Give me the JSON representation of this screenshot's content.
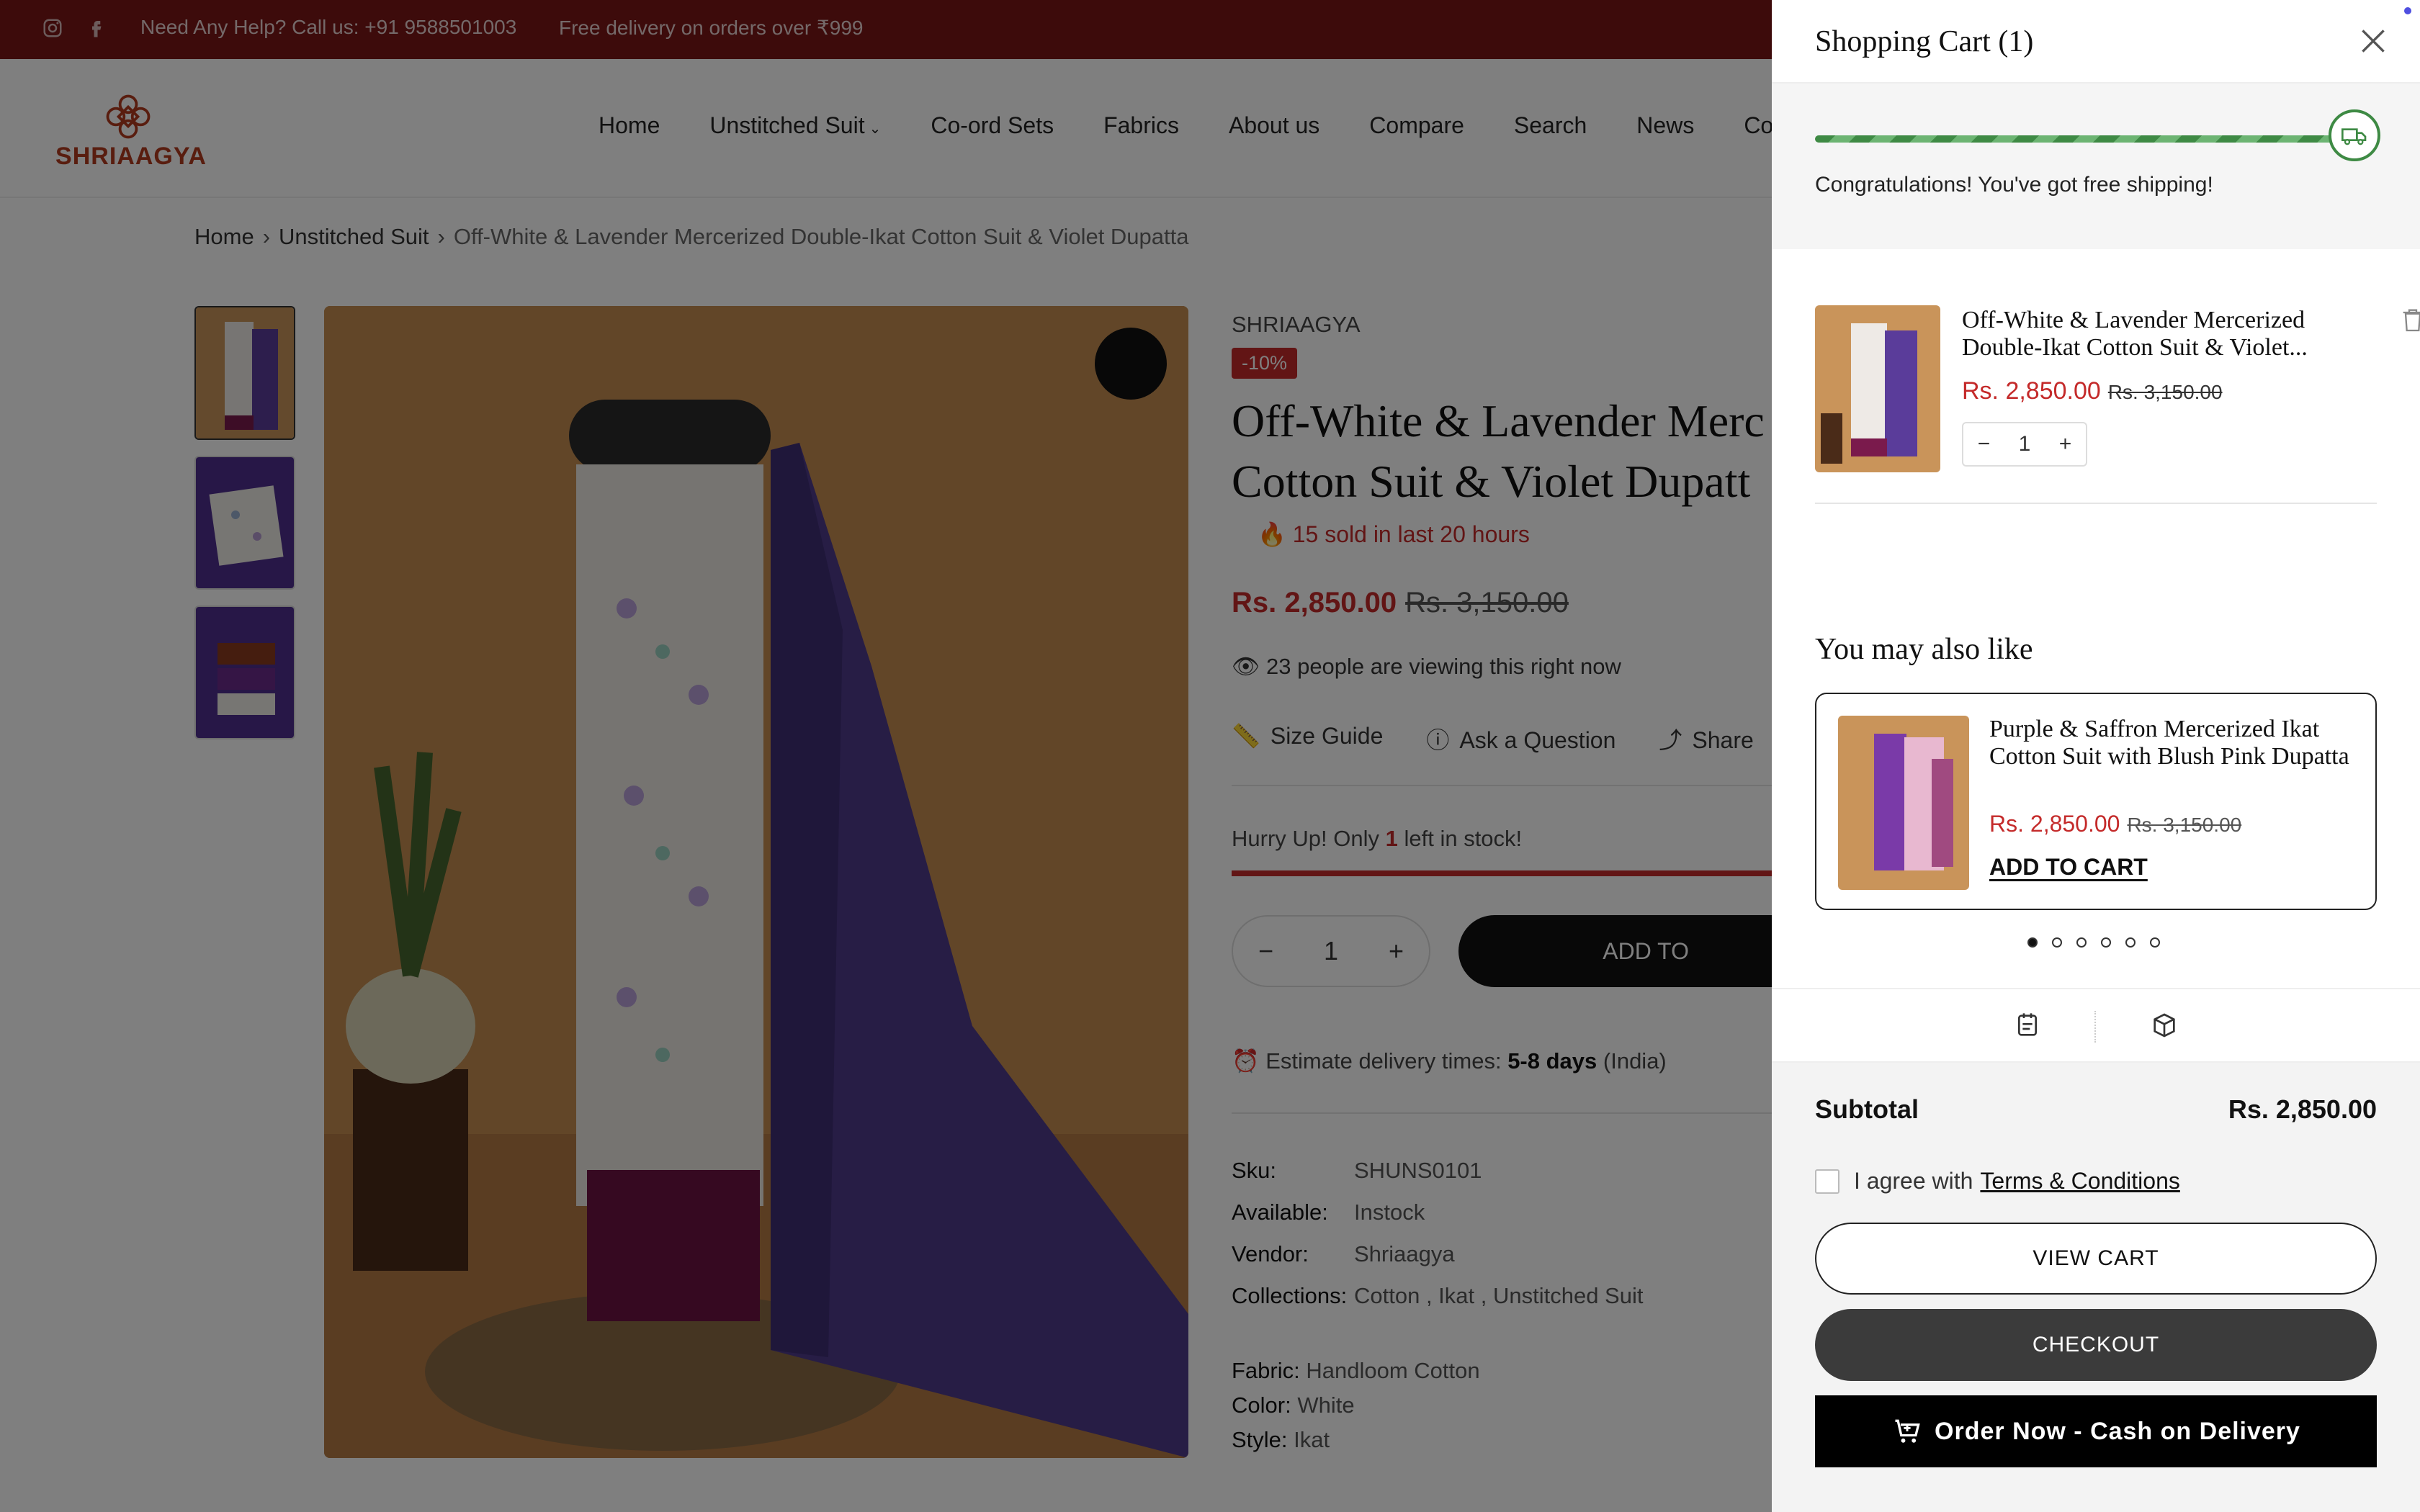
{
  "topbar": {
    "help_text": "Need Any Help? Call us: +91 9588501003",
    "free_delivery": "Free delivery on orders over ₹999",
    "icons": [
      "instagram-icon",
      "facebook-icon"
    ]
  },
  "header": {
    "logo_text": "SHRIAAGYA",
    "nav": [
      "Home",
      "Unstitched Suit",
      "Co-ord Sets",
      "Fabrics",
      "About us",
      "Compare",
      "Search",
      "News",
      "Con"
    ]
  },
  "breadcrumb": {
    "home": "Home",
    "category": "Unstitched Suit",
    "current": "Off-White & Lavender Mercerized Double-Ikat Cotton Suit & Violet Dupatta"
  },
  "product": {
    "brand": "SHRIAAGYA",
    "discount": "-10%",
    "title_line1": "Off-White & Lavender Merc",
    "title_line2": "Cotton Suit & Violet Dupatt",
    "sold": "15 sold in last 20 hours",
    "price": "Rs. 2,850.00",
    "compare_price": "Rs. 3,150.00",
    "viewing": "23 people are viewing this right now",
    "size_guide": "Size Guide",
    "ask": "Ask a Question",
    "share": "Share",
    "hurry_pre": "Hurry Up! Only",
    "hurry_n": "1",
    "hurry_post": "left in stock!",
    "stock_fraction": 1.0,
    "qty": "1",
    "add_to_cart": "ADD TO",
    "delivery_pre": "Estimate delivery times:",
    "delivery_days": "5-8 days",
    "delivery_post": "(India)",
    "meta": {
      "sku_k": "Sku:",
      "sku_v": "SHUNS0101",
      "avail_k": "Available:",
      "avail_v": "Instock",
      "vendor_k": "Vendor:",
      "vendor_v": "Shriaagya",
      "coll_k": "Collections:",
      "coll_v": "Cotton , Ikat , Unstitched Suit"
    },
    "attrs": {
      "fabric_k": "Fabric:",
      "fabric_v": "Handloom Cotton",
      "color_k": "Color:",
      "color_v": "White",
      "style_k": "Style:",
      "style_v": "Ikat"
    }
  },
  "cart": {
    "title": "Shopping Cart (1)",
    "free_shipping_msg": "Congratulations! You've got free shipping!",
    "free_shipping_progress": 1.0,
    "item": {
      "name": "Off-White & Lavender Mercerized Double-Ikat Cotton Suit & Violet...",
      "price": "Rs. 2,850.00",
      "compare_price": "Rs. 3,150.00",
      "qty": "1"
    },
    "you_may_also_like": "You may also like",
    "rec": {
      "name": "Purple & Saffron Mercerized Ikat Cotton Suit with Blush Pink Dupatta",
      "price": "Rs. 2,850.00",
      "compare_price": "Rs. 3,150.00",
      "add": "ADD TO CART"
    },
    "subtotal_label": "Subtotal",
    "subtotal_value": "Rs. 2,850.00",
    "agree": "I agree with",
    "terms": "Terms & Conditions",
    "view_cart": "VIEW CART",
    "checkout": "CHECKOUT",
    "cod": "Order Now - Cash on Delivery"
  },
  "colors": {
    "topbar": "#7b1616",
    "accent_red": "#c42a2a",
    "green": "#3e8a44",
    "logo": "#b23a1e"
  }
}
